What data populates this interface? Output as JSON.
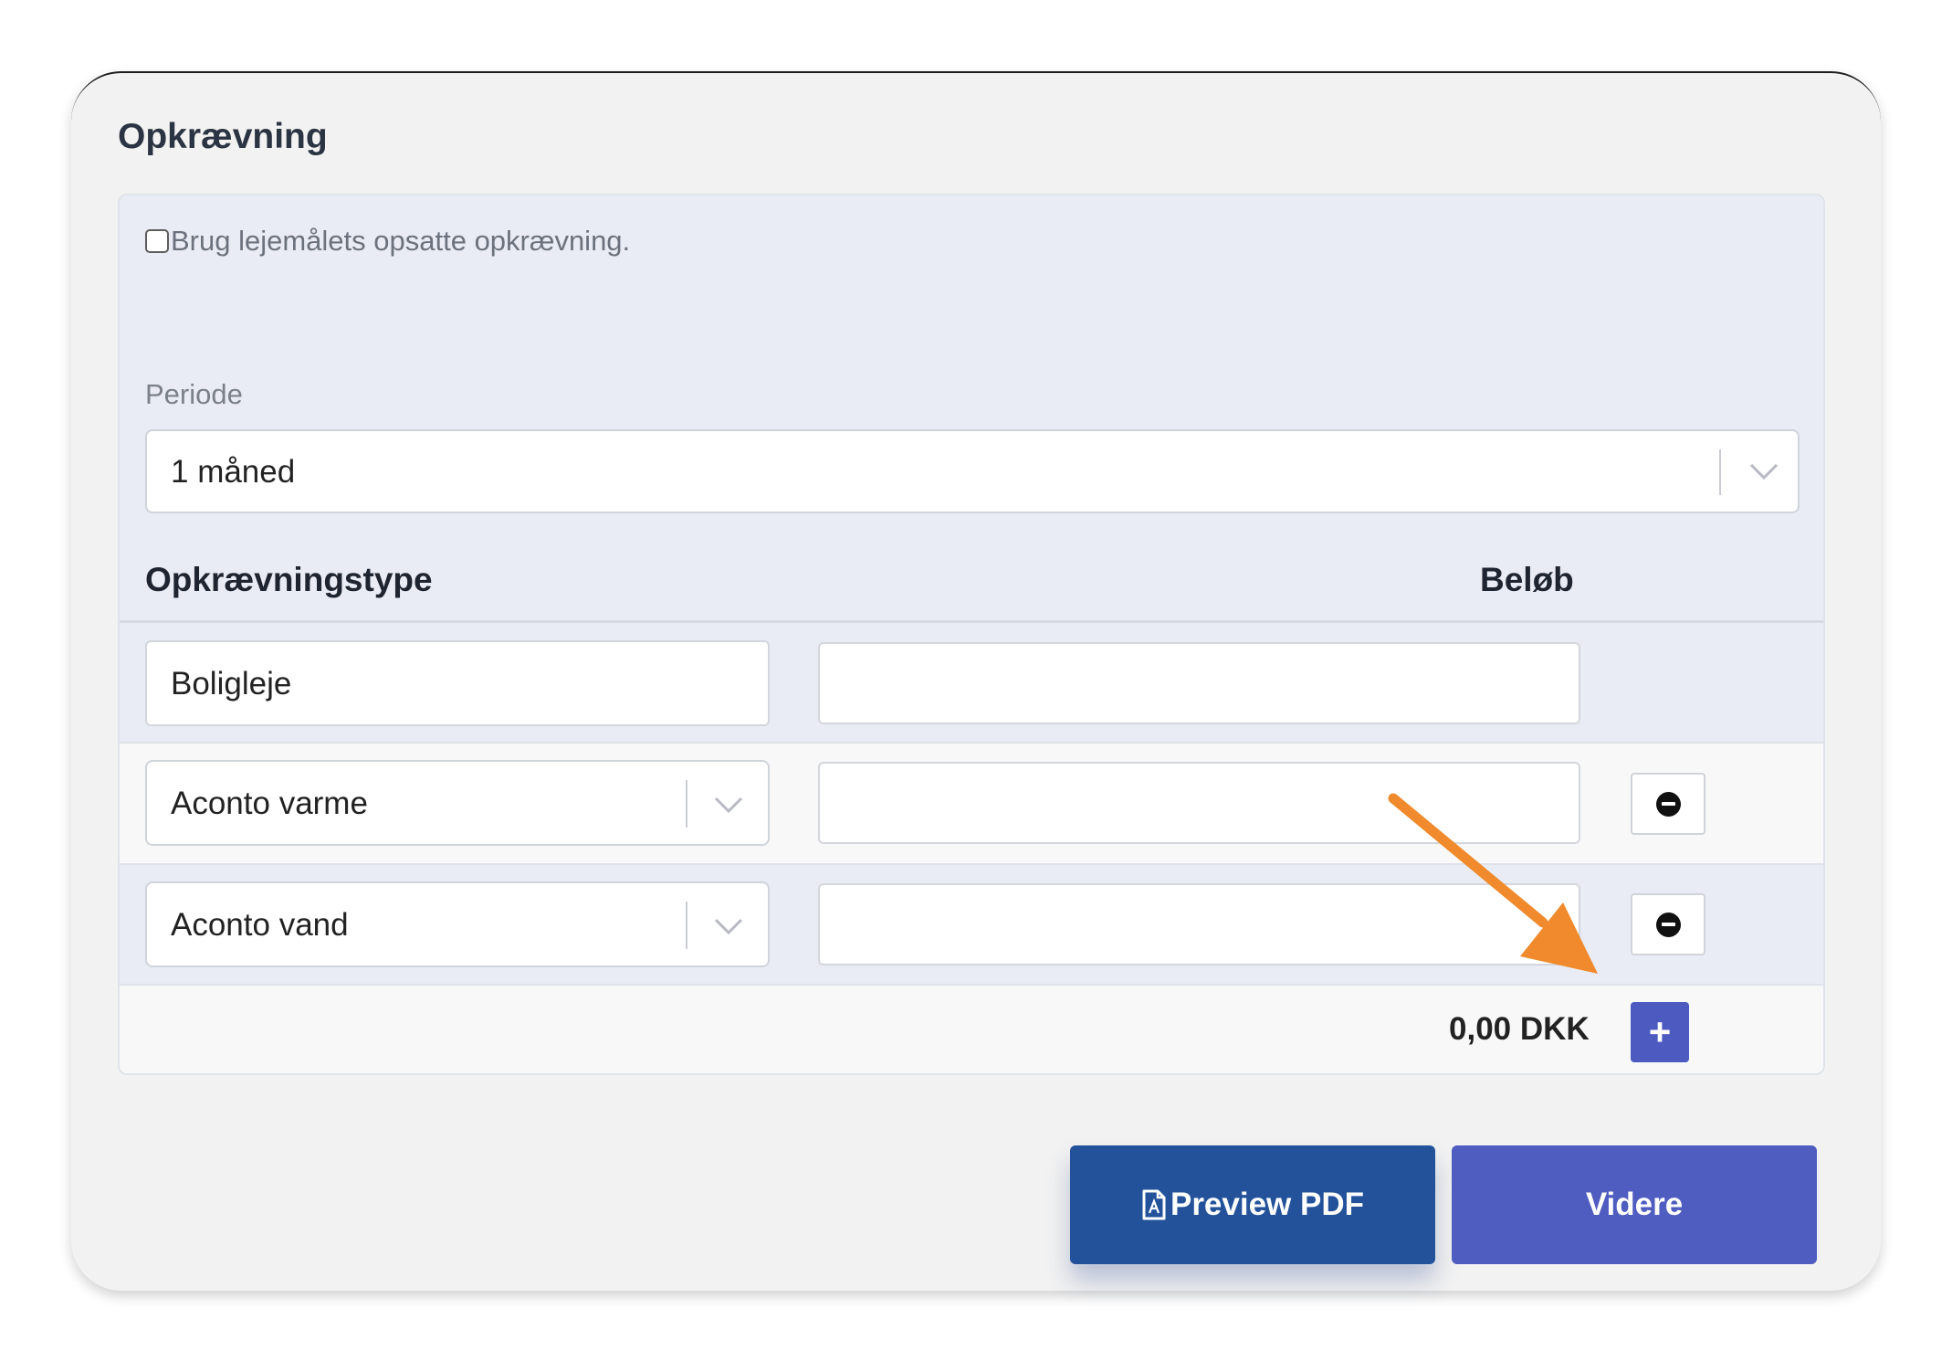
{
  "section": {
    "title": "Opkrævning"
  },
  "checkbox": {
    "label": "Brug lejemålets opsatte opkrævning.",
    "checked": false
  },
  "periode": {
    "label": "Periode",
    "value": "1 måned"
  },
  "table": {
    "headers": {
      "type": "Opkrævningstype",
      "amount": "Beløb"
    },
    "rows": [
      {
        "type": "Boligleje",
        "amount": "",
        "removable": false
      },
      {
        "type": "Aconto varme",
        "amount": "",
        "removable": true
      },
      {
        "type": "Aconto vand",
        "amount": "",
        "removable": true
      }
    ],
    "total": "0,00 DKK",
    "add_label": "+"
  },
  "buttons": {
    "preview": "Preview PDF",
    "next": "Videre"
  },
  "colors": {
    "primary": "#4f5cc0",
    "preview": "#23529b",
    "arrow": "#f08a2c"
  },
  "icons": {
    "dropdown": "chevron-down-icon",
    "remove": "minus-circle-icon",
    "pdf": "file-pdf-icon",
    "annotation": "arrow-icon"
  }
}
